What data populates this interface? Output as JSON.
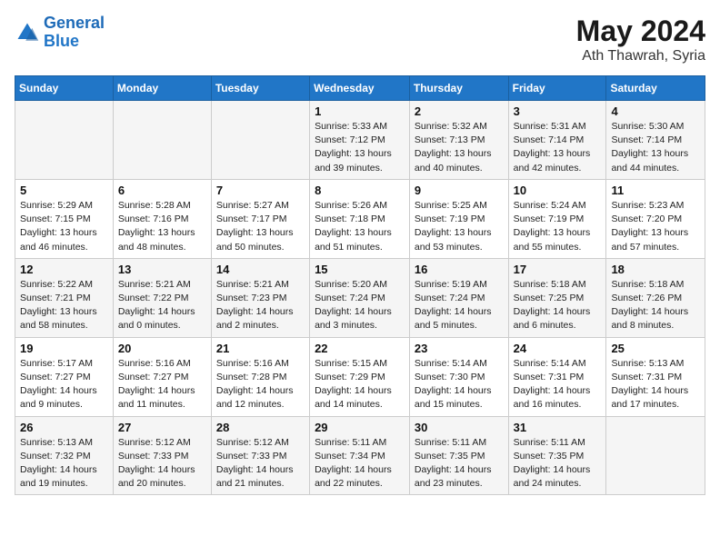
{
  "header": {
    "logo_line1": "General",
    "logo_line2": "Blue",
    "month_year": "May 2024",
    "location": "Ath Thawrah, Syria"
  },
  "weekdays": [
    "Sunday",
    "Monday",
    "Tuesday",
    "Wednesday",
    "Thursday",
    "Friday",
    "Saturday"
  ],
  "weeks": [
    [
      {
        "day": "",
        "info": ""
      },
      {
        "day": "",
        "info": ""
      },
      {
        "day": "",
        "info": ""
      },
      {
        "day": "1",
        "info": "Sunrise: 5:33 AM\nSunset: 7:12 PM\nDaylight: 13 hours\nand 39 minutes."
      },
      {
        "day": "2",
        "info": "Sunrise: 5:32 AM\nSunset: 7:13 PM\nDaylight: 13 hours\nand 40 minutes."
      },
      {
        "day": "3",
        "info": "Sunrise: 5:31 AM\nSunset: 7:14 PM\nDaylight: 13 hours\nand 42 minutes."
      },
      {
        "day": "4",
        "info": "Sunrise: 5:30 AM\nSunset: 7:14 PM\nDaylight: 13 hours\nand 44 minutes."
      }
    ],
    [
      {
        "day": "5",
        "info": "Sunrise: 5:29 AM\nSunset: 7:15 PM\nDaylight: 13 hours\nand 46 minutes."
      },
      {
        "day": "6",
        "info": "Sunrise: 5:28 AM\nSunset: 7:16 PM\nDaylight: 13 hours\nand 48 minutes."
      },
      {
        "day": "7",
        "info": "Sunrise: 5:27 AM\nSunset: 7:17 PM\nDaylight: 13 hours\nand 50 minutes."
      },
      {
        "day": "8",
        "info": "Sunrise: 5:26 AM\nSunset: 7:18 PM\nDaylight: 13 hours\nand 51 minutes."
      },
      {
        "day": "9",
        "info": "Sunrise: 5:25 AM\nSunset: 7:19 PM\nDaylight: 13 hours\nand 53 minutes."
      },
      {
        "day": "10",
        "info": "Sunrise: 5:24 AM\nSunset: 7:19 PM\nDaylight: 13 hours\nand 55 minutes."
      },
      {
        "day": "11",
        "info": "Sunrise: 5:23 AM\nSunset: 7:20 PM\nDaylight: 13 hours\nand 57 minutes."
      }
    ],
    [
      {
        "day": "12",
        "info": "Sunrise: 5:22 AM\nSunset: 7:21 PM\nDaylight: 13 hours\nand 58 minutes."
      },
      {
        "day": "13",
        "info": "Sunrise: 5:21 AM\nSunset: 7:22 PM\nDaylight: 14 hours\nand 0 minutes."
      },
      {
        "day": "14",
        "info": "Sunrise: 5:21 AM\nSunset: 7:23 PM\nDaylight: 14 hours\nand 2 minutes."
      },
      {
        "day": "15",
        "info": "Sunrise: 5:20 AM\nSunset: 7:24 PM\nDaylight: 14 hours\nand 3 minutes."
      },
      {
        "day": "16",
        "info": "Sunrise: 5:19 AM\nSunset: 7:24 PM\nDaylight: 14 hours\nand 5 minutes."
      },
      {
        "day": "17",
        "info": "Sunrise: 5:18 AM\nSunset: 7:25 PM\nDaylight: 14 hours\nand 6 minutes."
      },
      {
        "day": "18",
        "info": "Sunrise: 5:18 AM\nSunset: 7:26 PM\nDaylight: 14 hours\nand 8 minutes."
      }
    ],
    [
      {
        "day": "19",
        "info": "Sunrise: 5:17 AM\nSunset: 7:27 PM\nDaylight: 14 hours\nand 9 minutes."
      },
      {
        "day": "20",
        "info": "Sunrise: 5:16 AM\nSunset: 7:27 PM\nDaylight: 14 hours\nand 11 minutes."
      },
      {
        "day": "21",
        "info": "Sunrise: 5:16 AM\nSunset: 7:28 PM\nDaylight: 14 hours\nand 12 minutes."
      },
      {
        "day": "22",
        "info": "Sunrise: 5:15 AM\nSunset: 7:29 PM\nDaylight: 14 hours\nand 14 minutes."
      },
      {
        "day": "23",
        "info": "Sunrise: 5:14 AM\nSunset: 7:30 PM\nDaylight: 14 hours\nand 15 minutes."
      },
      {
        "day": "24",
        "info": "Sunrise: 5:14 AM\nSunset: 7:31 PM\nDaylight: 14 hours\nand 16 minutes."
      },
      {
        "day": "25",
        "info": "Sunrise: 5:13 AM\nSunset: 7:31 PM\nDaylight: 14 hours\nand 17 minutes."
      }
    ],
    [
      {
        "day": "26",
        "info": "Sunrise: 5:13 AM\nSunset: 7:32 PM\nDaylight: 14 hours\nand 19 minutes."
      },
      {
        "day": "27",
        "info": "Sunrise: 5:12 AM\nSunset: 7:33 PM\nDaylight: 14 hours\nand 20 minutes."
      },
      {
        "day": "28",
        "info": "Sunrise: 5:12 AM\nSunset: 7:33 PM\nDaylight: 14 hours\nand 21 minutes."
      },
      {
        "day": "29",
        "info": "Sunrise: 5:11 AM\nSunset: 7:34 PM\nDaylight: 14 hours\nand 22 minutes."
      },
      {
        "day": "30",
        "info": "Sunrise: 5:11 AM\nSunset: 7:35 PM\nDaylight: 14 hours\nand 23 minutes."
      },
      {
        "day": "31",
        "info": "Sunrise: 5:11 AM\nSunset: 7:35 PM\nDaylight: 14 hours\nand 24 minutes."
      },
      {
        "day": "",
        "info": ""
      }
    ]
  ]
}
